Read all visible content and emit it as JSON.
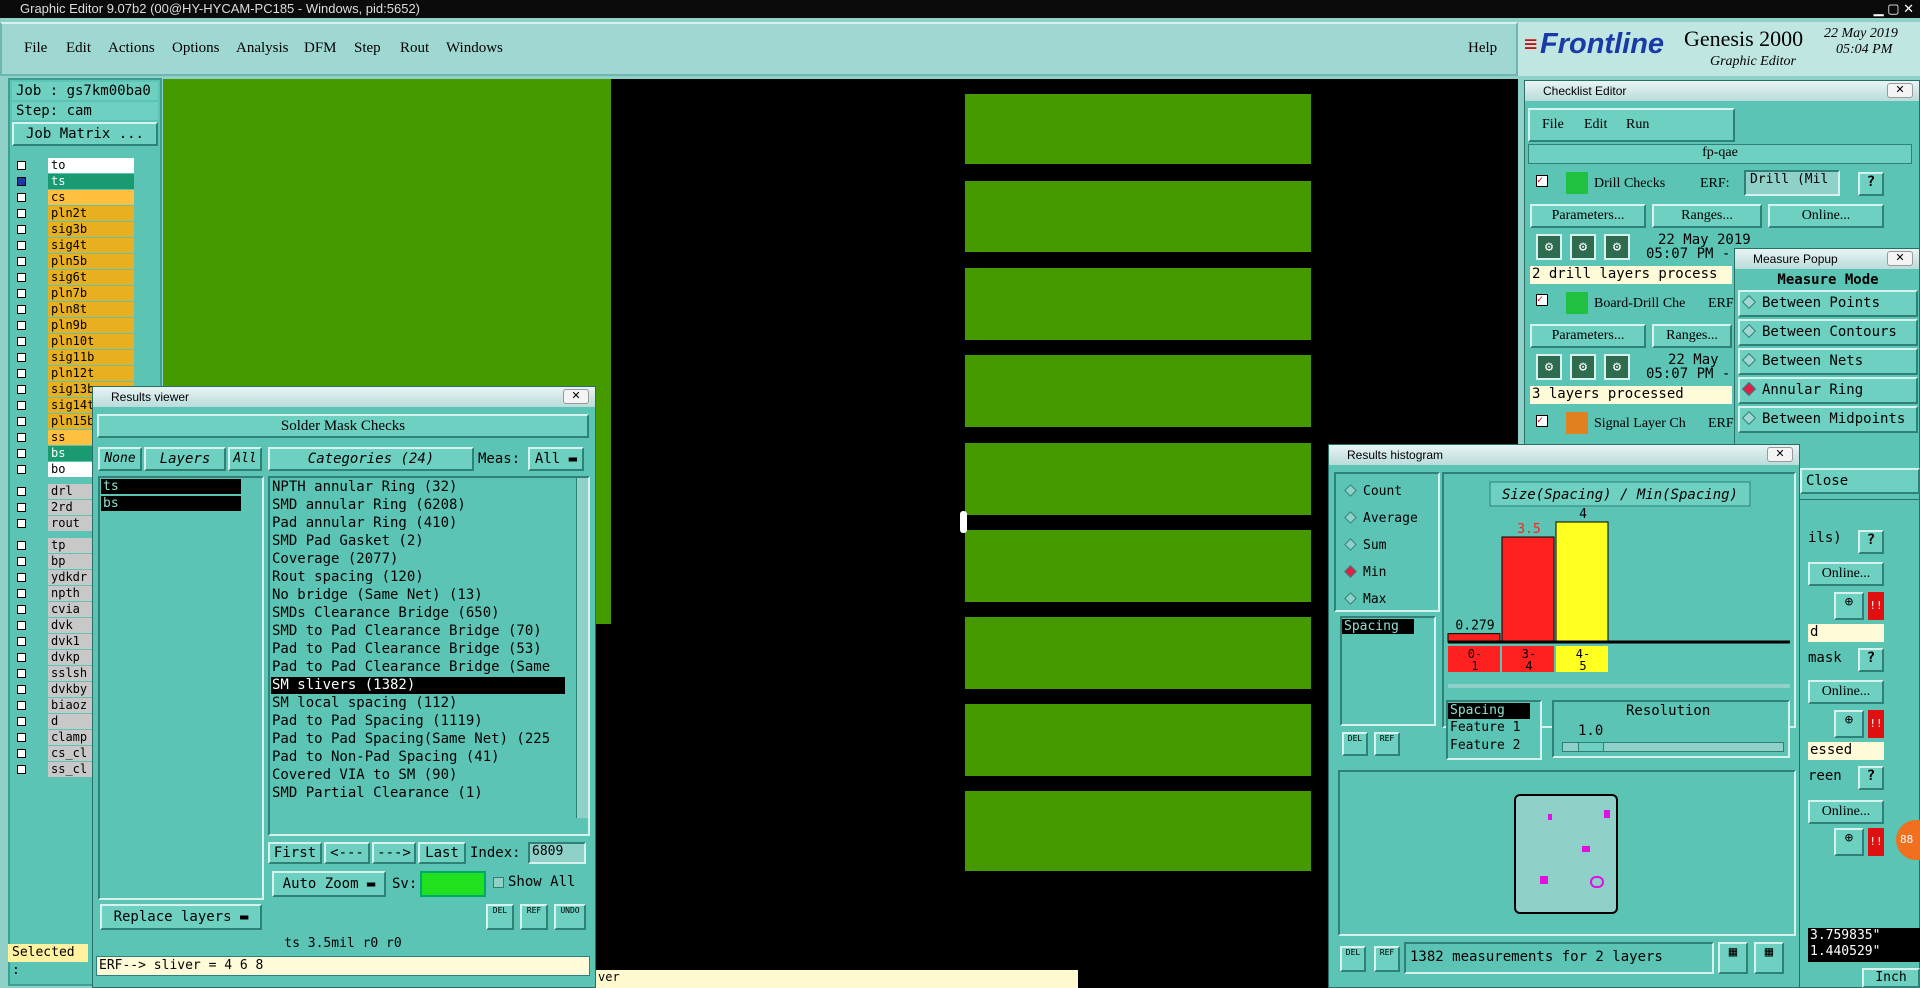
{
  "window_title": "Graphic Editor 9.07b2 (00@HY-HYCAM-PC185 - Windows, pid:5652)",
  "menu": [
    "File",
    "Edit",
    "Actions",
    "Options",
    "Analysis",
    "DFM",
    "Step",
    "Rout",
    "Windows"
  ],
  "help": "Help",
  "brand": {
    "logo": "Frontline",
    "product": "Genesis 2000",
    "subtitle": "Graphic Editor",
    "date": "22 May 2019",
    "time": "05:04 PM"
  },
  "job": {
    "job_label": "Job : gs7km00ba0",
    "step_label": "Step: cam",
    "matrix_button": "Job Matrix ..."
  },
  "layers": [
    "to",
    "ts",
    "cs",
    "pln2t",
    "sig3b",
    "sig4t",
    "pln5b",
    "sig6t",
    "pln7b",
    "pln8t",
    "pln9b",
    "pln10t",
    "sig11b",
    "pln12t",
    "sig13b",
    "sig14t",
    "pln15b",
    "ss",
    "bs",
    "bo"
  ],
  "layers2": [
    "drl",
    "2rd",
    "rout"
  ],
  "layers3": [
    "tp",
    "bp",
    "ydkdr",
    "npth",
    "cvia",
    "dvk",
    "dvk1",
    "dvkp",
    "sslsh",
    "dvkby",
    "biaoz",
    "d",
    "clamp",
    "cs_cl",
    "ss_cl"
  ],
  "selected_label": "Selected :",
  "results_viewer": {
    "title": "Results viewer",
    "header": "Solder Mask Checks",
    "btn_none": "None",
    "btn_layers": "Layers",
    "btn_all": "All",
    "categories_btn": "Categories (24)",
    "meas_label": "Meas:",
    "meas_value": "All",
    "layer_items": [
      "ts",
      "bs"
    ],
    "categories": [
      "NPTH annular Ring (32)",
      "SMD annular Ring (6208)",
      "Pad annular Ring (410)",
      "SMD Pad Gasket (2)",
      "Coverage (2077)",
      "Rout spacing (120)",
      "No bridge (Same Net) (13)",
      "SMDs Clearance Bridge (650)",
      "SMD to Pad Clearance Bridge (70)",
      "Pad to Pad Clearance Bridge (53)",
      "Pad to Pad Clearance Bridge (Same",
      "SM slivers (1382)",
      "SM local spacing (112)",
      "Pad to Pad Spacing (1119)",
      "Pad to Pad Spacing(Same Net) (225",
      "Pad to Non-Pad Spacing (41)",
      "Covered VIA to SM (90)",
      "SMD Partial Clearance (1)"
    ],
    "selected_category_index": 11,
    "nav": {
      "first": "First",
      "prev": "<---",
      "next": "--->",
      "last": "Last",
      "index_label": "Index:",
      "index_value": "6809"
    },
    "auto_zoom": "Auto Zoom",
    "sv_label": "Sv:",
    "show_all": "Show All",
    "replace_layers": "Replace layers",
    "del": "DEL",
    "ref": "REF",
    "undo": "UNDO",
    "status": "ts 3.5mil  r0  r0",
    "erf": "ERF--> sliver = 4 6 8"
  },
  "checklist": {
    "title": "Checklist Editor",
    "menu": [
      "File",
      "Edit",
      "Run"
    ],
    "name": "fp-qae",
    "drill_checks": "Drill Checks",
    "erf_label": "ERF:",
    "erf_value": "Drill (Mil",
    "params": "Parameters...",
    "ranges": "Ranges...",
    "online": "Online...",
    "date1": "22 May 2019",
    "time1": "05:07 PM -",
    "status1": "2 drill layers process",
    "board_drill": "Board-Drill Che",
    "erf2": "ERF",
    "date2": "22 May",
    "time2": "05:07 PM -",
    "status2": "3 layers processed",
    "signal": "Signal Layer Ch",
    "erf3": "ERF",
    "right_frag": [
      "ils)",
      "Online...",
      "d",
      "mask",
      "Online...",
      "essed",
      "reen",
      "Online..."
    ],
    "coords": [
      "3.759835\"",
      "1.440529\""
    ],
    "unit": "Inch"
  },
  "measure_popup": {
    "title": "Measure Popup",
    "header": "Measure Mode",
    "options": [
      "Between Points",
      "Between Contours",
      "Between Nets",
      "Annular Ring",
      "Between Midpoints"
    ],
    "selected": "Annular Ring",
    "close": "Close"
  },
  "histogram": {
    "title": "Results histogram",
    "stats": [
      "Count",
      "Average",
      "Sum",
      "Min",
      "Max"
    ],
    "selected_stat": "Min",
    "list": [
      "Spacing"
    ],
    "chart_title": "Size(Spacing) / Min(Spacing)",
    "field_list": [
      "Spacing",
      "Feature 1",
      "Feature 2"
    ],
    "resolution_label": "Resolution",
    "resolution_value": "1.0",
    "footer": "1382 measurements for 2 layers",
    "del": "DEL",
    "ref": "REF"
  },
  "chart_data": {
    "type": "bar",
    "title": "Size(Spacing) / Min(Spacing)",
    "categories": [
      "0-1",
      "3-4",
      "4-5"
    ],
    "values": [
      0.279,
      3.5,
      4
    ],
    "value_labels": [
      "0.279",
      "3.5",
      "4"
    ],
    "colors": [
      "#ff2020",
      "#ff2020",
      "#ffff20"
    ],
    "ylim": [
      0,
      4
    ]
  },
  "bottom_fragment": "ver"
}
